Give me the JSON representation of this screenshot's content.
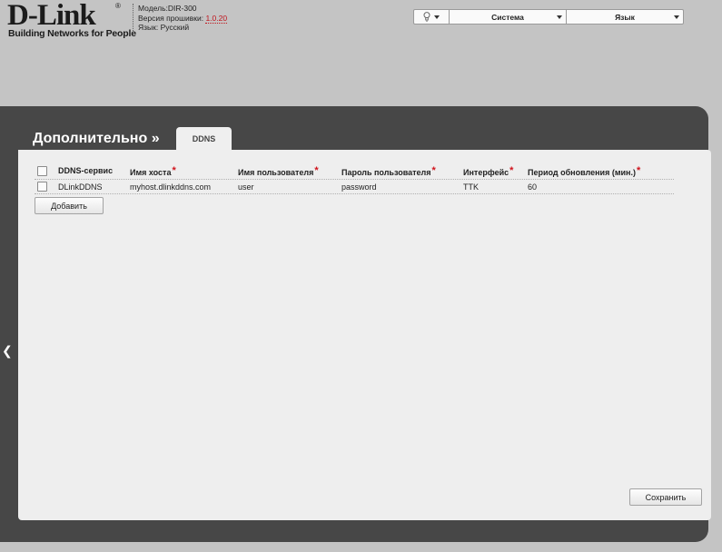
{
  "header": {
    "logo_text": "D-Link",
    "logo_reg": "®",
    "logo_tagline": "Building Networks for People",
    "model_label": "Модель:",
    "model_value": "DIR-300",
    "firmware_label": "Версия прошивки:",
    "firmware_value": "1.0.20",
    "language_label": "Язык:",
    "language_value": "Русский"
  },
  "top_menu": {
    "system_label": "Система",
    "language_label": "Язык"
  },
  "panel": {
    "title": "Дополнительно »",
    "active_tab": "DDNS",
    "back_arrow": "❮"
  },
  "table": {
    "columns": [
      "DDNS-сервис",
      "Имя хоста",
      "Имя пользователя",
      "Пароль пользователя",
      "Интерфейс",
      "Период обновления (мин.)"
    ],
    "required_marker": "*",
    "rows": [
      {
        "service": "DLinkDDNS",
        "host": "myhost.dlinkddns.com",
        "user": "user",
        "password": "password",
        "interface": "TTK",
        "period": "60"
      }
    ]
  },
  "buttons": {
    "add": "Добавить",
    "save": "Сохранить"
  }
}
